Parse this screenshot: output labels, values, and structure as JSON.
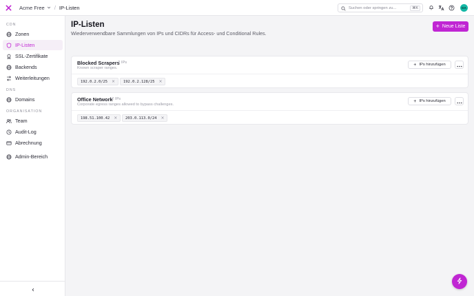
{
  "header": {
    "org_label": "Acme Free",
    "separator": "/",
    "page_label": "IP-Listen",
    "search": {
      "placeholder": "Suchen oder springen zu...",
      "shortcut": "⌘K"
    },
    "avatar_initials": "DA",
    "icons": [
      "bell-icon",
      "translate-icon",
      "help-icon"
    ]
  },
  "sidebar": {
    "sections": [
      {
        "label": "CDN"
      },
      {
        "label": "DNS"
      },
      {
        "label": "ORGANISATION"
      }
    ],
    "items": [
      {
        "label": "Zonen",
        "icon": "globe-icon"
      },
      {
        "label": "IP-Listen",
        "icon": "shield-icon",
        "active": true
      },
      {
        "label": "SSL-Zertifikate",
        "icon": "certificate-icon"
      },
      {
        "label": "Backends",
        "icon": "globe-icon"
      },
      {
        "label": "Weiterleitungen",
        "icon": "redirect-icon"
      },
      {
        "label": "Domains",
        "icon": "globe-icon"
      },
      {
        "label": "Team",
        "icon": "users-icon"
      },
      {
        "label": "Audit-Log",
        "icon": "clock-icon"
      },
      {
        "label": "Abrechnung",
        "icon": "card-icon"
      },
      {
        "label": "Admin-Bereich",
        "icon": "globe-icon"
      }
    ]
  },
  "main": {
    "title": "IP-Listen",
    "subtitle": "Wiederverwendbare Sammlungen von IPs und CIDRs für Access- und Conditional Rules.",
    "new_button": "Neue Liste",
    "add_ips_label": "IPs hinzufügen",
    "lists": [
      {
        "name": "Blocked Scrapers",
        "count": "2 IPs",
        "description": "Known scraper ranges.",
        "entries": [
          "192.0.2.0/25",
          "192.0.2.128/25"
        ]
      },
      {
        "name": "Office Network",
        "count": "2 IPs",
        "description": "Corporate egress ranges allowed to bypass challenges.",
        "entries": [
          "198.51.100.42",
          "203.0.113.0/24"
        ]
      }
    ]
  },
  "colors": {
    "accent": "#c026d3",
    "active_bg": "#f5eff7",
    "avatar": "#14b8a6"
  }
}
